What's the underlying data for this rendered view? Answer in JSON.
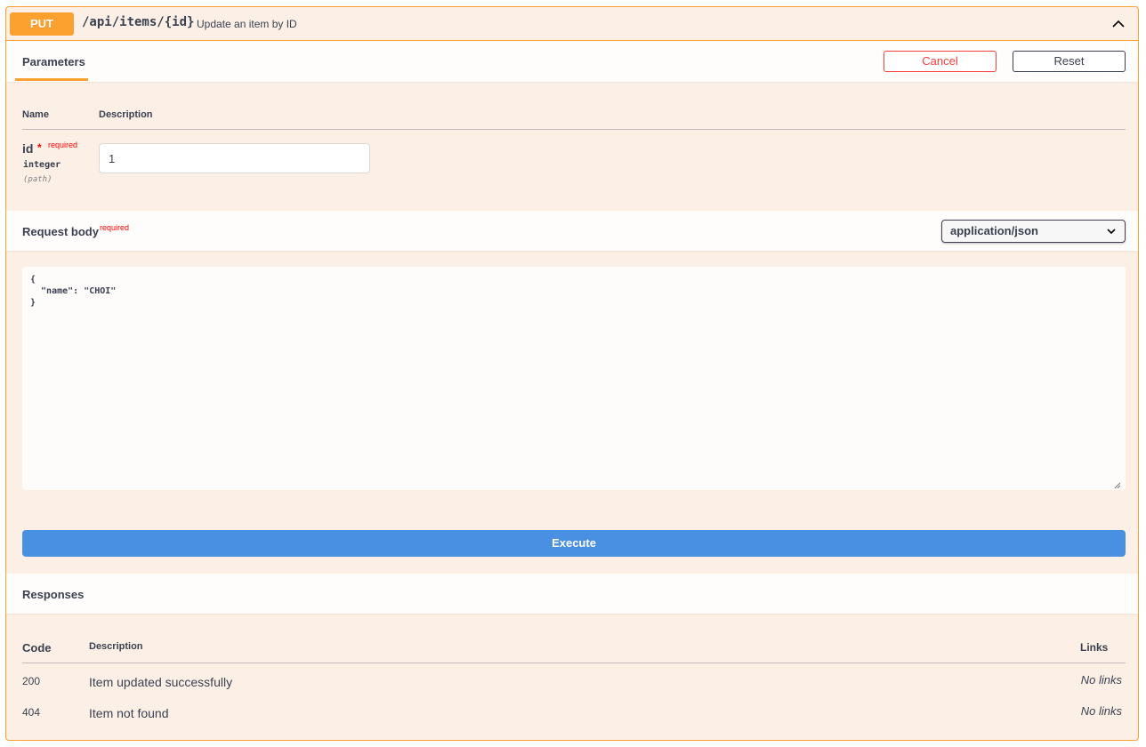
{
  "operation": {
    "method": "PUT",
    "path": "/api/items/{id}",
    "summary": "Update an item by ID"
  },
  "parameters_section": {
    "tab_label": "Parameters",
    "cancel_label": "Cancel",
    "reset_label": "Reset",
    "col_name": "Name",
    "col_description": "Description",
    "params": [
      {
        "name": "id",
        "required_star": "*",
        "required_label": "required",
        "type": "integer",
        "in": "(path)",
        "value": "1"
      }
    ]
  },
  "request_body": {
    "title": "Request body",
    "required_label": "required",
    "content_type": "application/json",
    "body": "{\n  \"name\": \"CHOI\"\n}"
  },
  "execute_label": "Execute",
  "responses": {
    "title": "Responses",
    "col_code": "Code",
    "col_description": "Description",
    "col_links": "Links",
    "rows": [
      {
        "code": "200",
        "description": "Item updated successfully",
        "links": "No links"
      },
      {
        "code": "404",
        "description": "Item not found",
        "links": "No links"
      }
    ]
  },
  "colors": {
    "put_accent": "#fca130",
    "block_background": "#fcf0e6",
    "execute_blue": "#4990e2",
    "cancel_red": "#f93e3e",
    "required_red": "#ff0000"
  }
}
